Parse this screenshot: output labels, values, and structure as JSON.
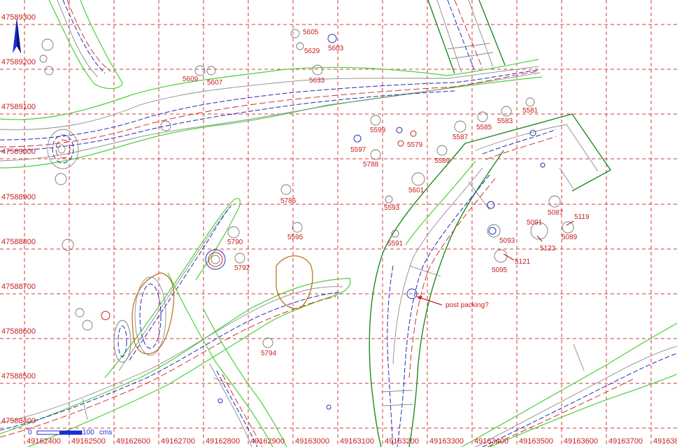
{
  "map": {
    "x_labels": [
      "49162400",
      "49162500",
      "49162600",
      "49162700",
      "49162800",
      "49162900",
      "49163000",
      "49163100",
      "49163200",
      "49163300",
      "49163400",
      "49163500",
      "49163600",
      "49163700",
      "4916380"
    ],
    "y_labels": [
      "47589300",
      "47589200",
      "47589100",
      "47589000",
      "47588900",
      "47588800",
      "47588700",
      "47588600",
      "47588500",
      "47588400"
    ],
    "features": [
      {
        "id": "5605"
      },
      {
        "id": "5629"
      },
      {
        "id": "5603"
      },
      {
        "id": "5609"
      },
      {
        "id": "5607"
      },
      {
        "id": "5633"
      },
      {
        "id": "5581"
      },
      {
        "id": "5583"
      },
      {
        "id": "5585"
      },
      {
        "id": "5587"
      },
      {
        "id": "5599"
      },
      {
        "id": "5597"
      },
      {
        "id": "5579"
      },
      {
        "id": "5788"
      },
      {
        "id": "5589"
      },
      {
        "id": "5601"
      },
      {
        "id": "5786"
      },
      {
        "id": "5593"
      },
      {
        "id": "5087"
      },
      {
        "id": "5119"
      },
      {
        "id": "5091"
      },
      {
        "id": "5089"
      },
      {
        "id": "5093"
      },
      {
        "id": "5123"
      },
      {
        "id": "5121"
      },
      {
        "id": "5095"
      },
      {
        "id": "5790"
      },
      {
        "id": "5595"
      },
      {
        "id": "5591"
      },
      {
        "id": "5792"
      },
      {
        "id": "5794"
      }
    ],
    "annotation": "post packing?",
    "scale_bar": {
      "start": "0",
      "end": "100",
      "unit": "cms"
    },
    "colors": {
      "grid": "#d23a3a",
      "label": "#c81e1e",
      "edge": "#4ccf3d",
      "ditch": "#1f8a1f",
      "hachure_blue": "#1d2bb5",
      "orange": "#c06a10"
    }
  }
}
